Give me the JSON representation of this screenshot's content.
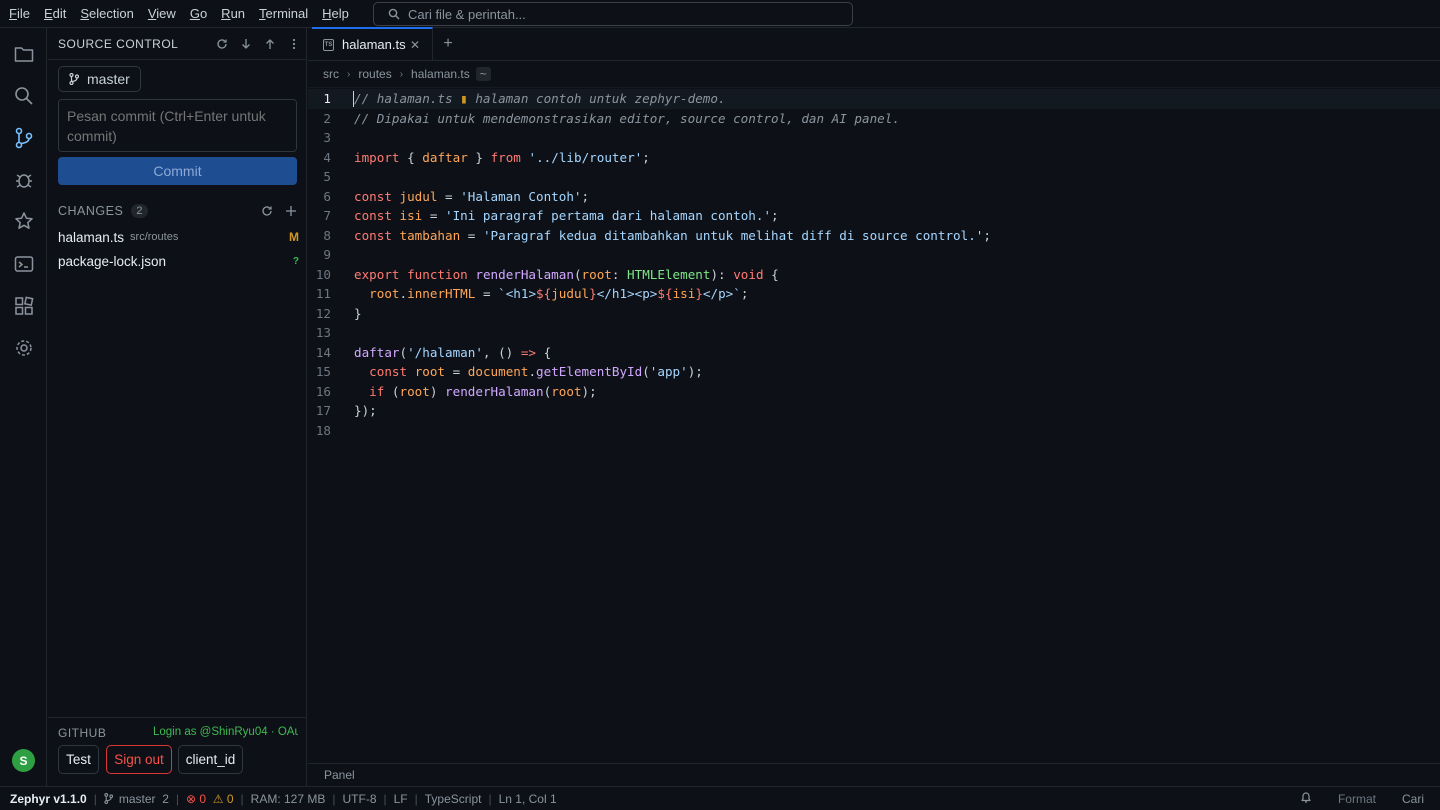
{
  "menu": [
    "File",
    "Edit",
    "Selection",
    "View",
    "Go",
    "Run",
    "Terminal",
    "Help"
  ],
  "search": {
    "placeholder": "Cari file & perintah..."
  },
  "activity": {
    "icons": [
      "files-icon",
      "search-icon",
      "source-control-icon",
      "debug-icon",
      "star-icon",
      "terminal-icon",
      "extensions-icon",
      "settings-icon"
    ],
    "avatar_letter": "S",
    "avatar_color": "#2ea043"
  },
  "sidebar": {
    "title": "SOURCE CONTROL",
    "branch": "master",
    "commit_placeholder": "Pesan commit (Ctrl+Enter untuk commit)",
    "commit_label": "Commit",
    "changes_title": "CHANGES",
    "changes_count": "2",
    "changes": [
      {
        "name": "halaman.ts",
        "path": "src/routes",
        "status": "M",
        "status_color": "#d29922"
      },
      {
        "name": "package-lock.json",
        "path": "",
        "status": "?",
        "status_color": "#3fb950"
      }
    ],
    "github_title": "GITHUB",
    "github_login": "Login as @ShinRyu04 · OAu...",
    "github_buttons": [
      "Test",
      "Sign out",
      "client_id"
    ]
  },
  "editor": {
    "tab_label": "halaman.ts",
    "tab_icon_text": "TS",
    "tab_close": "✕",
    "tab_add": "+",
    "breadcrumb": [
      "src",
      "routes",
      "halaman.ts"
    ],
    "breadcrumb_extra": "~",
    "line_numbers": [
      "1",
      "2",
      "3",
      "4",
      "5",
      "6",
      "7",
      "8",
      "9",
      "10",
      "11",
      "12",
      "13",
      "14",
      "15",
      "16",
      "17",
      "18"
    ],
    "panel_label": "Panel"
  },
  "statusbar": {
    "app": "Zephyr v1.1.0",
    "branch": "master",
    "branch_count": "2",
    "errors": "0",
    "warnings": "0",
    "ram": "RAM: 127 MB",
    "encoding": "UTF-8",
    "eol": "LF",
    "language": "TypeScript",
    "position": "Ln 1, Col 1",
    "format": "Format",
    "cari": "Cari"
  }
}
